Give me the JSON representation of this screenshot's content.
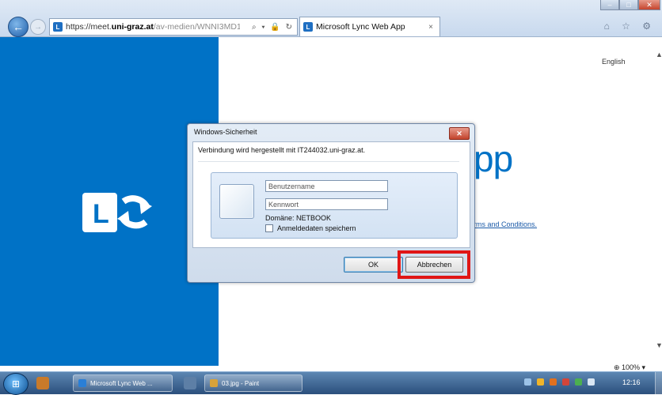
{
  "browser": {
    "url_domain_prefix": "https://meet.",
    "url_domain": "uni-graz.at",
    "url_path": "/av-medien/WNNI3MD1",
    "address_icons": "⌕ ▾ 🔒 ↻",
    "tab_title": "Microsoft Lync Web App",
    "tab_close": "×",
    "right_icons": "⌂ ☆ ⚙",
    "back_glyph": "←",
    "forward_glyph": "→"
  },
  "window_controls": {
    "minimize": "–",
    "maximize": "□",
    "close": "✕"
  },
  "page": {
    "language_link": "English",
    "heading": "pp",
    "terms_link": "rms and Conditions.",
    "zoom": "⊕ 100%  ▾",
    "scroll_up": "▲",
    "scroll_down": "▼",
    "brand_color": "#0072c6"
  },
  "dialog": {
    "title": "Windows-Sicherheit",
    "close": "✕",
    "message": "Verbindung wird hergestellt mit IT244032.uni-graz.at.",
    "username_placeholder": "Benutzername",
    "password_placeholder": "Kennwort",
    "domain": "Domäne: NETBOOK",
    "remember_label": "Anmeldedaten speichern",
    "ok_label": "OK",
    "cancel_label": "Abbrechen",
    "highlight_color": "#e01616"
  },
  "taskbar": {
    "task1": "Microsoft Lync Web ...",
    "task2": "03.jpg - Paint",
    "clock": "12:16"
  }
}
